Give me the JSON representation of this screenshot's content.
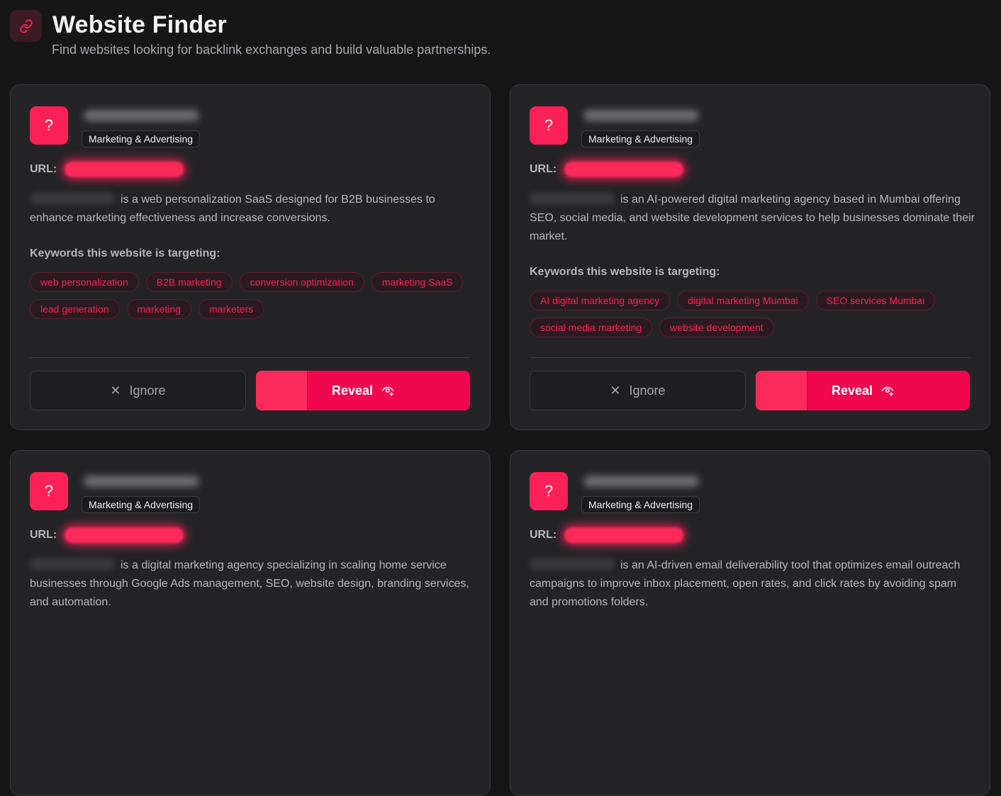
{
  "header": {
    "title": "Website Finder",
    "subtitle": "Find websites looking for backlink exchanges and build valuable partnerships.",
    "icon": "link-icon",
    "accent": "#fb2056"
  },
  "labels": {
    "url": "URL:",
    "keywords_title": "Keywords this website is targeting:",
    "ignore": "Ignore",
    "reveal": "Reveal"
  },
  "cards": [
    {
      "category": "Marketing & Advertising",
      "icon": "question-icon",
      "description": "is a web personalization SaaS designed for B2B businesses to enhance marketing effectiveness and increase conversions.",
      "keywords": [
        "web personalization",
        "B2B marketing",
        "conversion optimization",
        "marketing SaaS",
        "lead generation",
        "marketing",
        "marketers"
      ]
    },
    {
      "category": "Marketing & Advertising",
      "icon": "question-icon",
      "description": "is an AI-powered digital marketing agency based in Mumbai offering SEO, social media, and website development services to help businesses dominate their market.",
      "keywords": [
        "AI digital marketing agency",
        "digital marketing Mumbai",
        "SEO services Mumbai",
        "social media marketing",
        "website development"
      ]
    },
    {
      "category": "Marketing & Advertising",
      "icon": "question-icon",
      "description": "is a digital marketing agency specializing in scaling home service businesses through Google Ads management, SEO, website design, branding services, and automation.",
      "keywords": []
    },
    {
      "category": "Marketing & Advertising",
      "icon": "question-icon",
      "description": "is an AI-driven email deliverability tool that optimizes email outreach campaigns to improve inbox placement, open rates, and click rates by avoiding spam and promotions folders.",
      "keywords": []
    }
  ]
}
